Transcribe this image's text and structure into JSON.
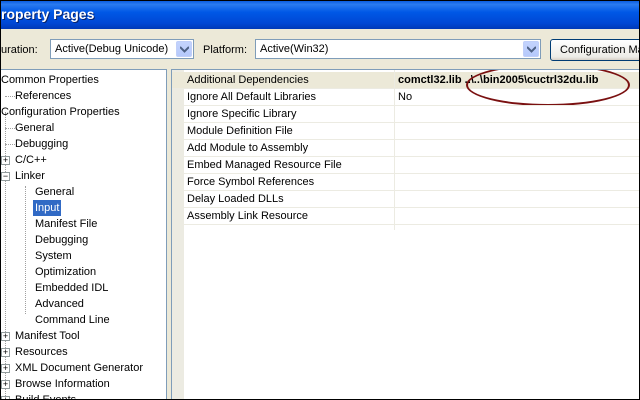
{
  "window": {
    "title": "roperty Pages"
  },
  "config_bar": {
    "configuration_label": "uration:",
    "configuration_value": "Active(Debug Unicode)",
    "platform_label": "Platform:",
    "platform_value": "Active(Win32)",
    "config_manager_label": "Configuration Ma"
  },
  "tree": {
    "items": [
      {
        "label": "Common Properties"
      },
      {
        "label": "References"
      },
      {
        "label": "Configuration Properties"
      },
      {
        "label": "General"
      },
      {
        "label": "Debugging"
      },
      {
        "label": "C/C++"
      },
      {
        "label": "Linker"
      },
      {
        "label": "General"
      },
      {
        "label": "Input",
        "selected": true
      },
      {
        "label": "Manifest File"
      },
      {
        "label": "Debugging"
      },
      {
        "label": "System"
      },
      {
        "label": "Optimization"
      },
      {
        "label": "Embedded IDL"
      },
      {
        "label": "Advanced"
      },
      {
        "label": "Command Line"
      },
      {
        "label": "Manifest Tool"
      },
      {
        "label": "Resources"
      },
      {
        "label": "XML Document Generator"
      },
      {
        "label": "Browse Information"
      },
      {
        "label": "Build Events"
      }
    ]
  },
  "properties": {
    "rows": [
      {
        "name": "Additional Dependencies",
        "value_a": "comctl32.lib",
        "value_b": "..\\..\\bin2005\\cuctrl32du.lib"
      },
      {
        "name": "Ignore All Default Libraries",
        "value": "No"
      },
      {
        "name": "Ignore Specific Library",
        "value": ""
      },
      {
        "name": "Module Definition File",
        "value": ""
      },
      {
        "name": "Add Module to Assembly",
        "value": ""
      },
      {
        "name": "Embed Managed Resource File",
        "value": ""
      },
      {
        "name": "Force Symbol References",
        "value": ""
      },
      {
        "name": "Delay Loaded DLLs",
        "value": ""
      },
      {
        "name": "Assembly Link Resource",
        "value": ""
      }
    ]
  },
  "colors": {
    "title_bar": "#0058e6",
    "selection": "#316ac5",
    "annotation_oval": "#7a1010"
  }
}
